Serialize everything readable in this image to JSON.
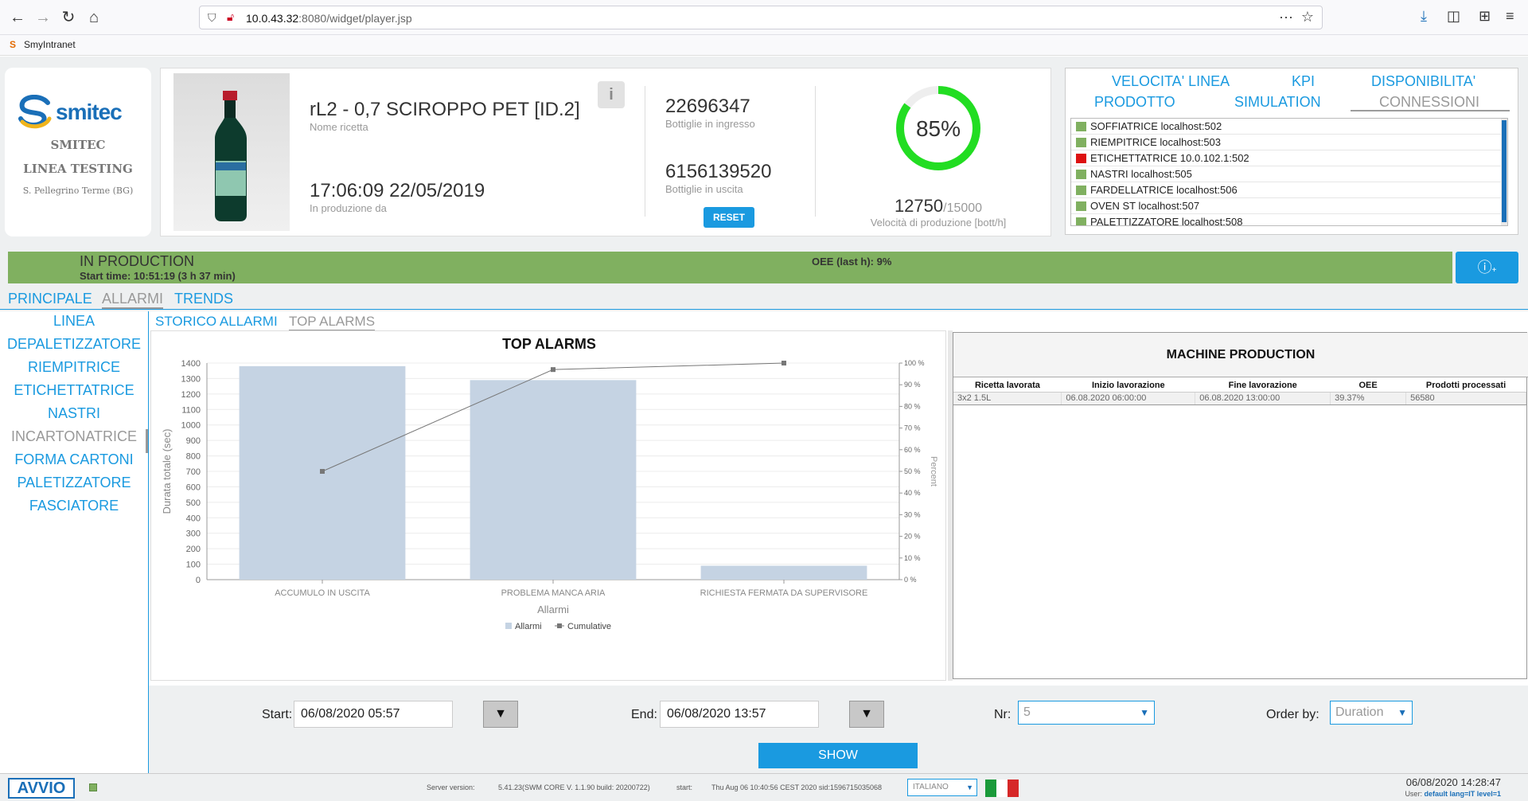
{
  "browser": {
    "url_host": "10.0.43.32",
    "url_rest": ":8080/widget/player.jsp",
    "bookmark": "SmyIntranet"
  },
  "brand": {
    "logo_text": "smitec",
    "company": "SMITEC",
    "line": "LINEA TESTING",
    "location": "S. Pellegrino Terme (BG)"
  },
  "recipe": {
    "title": "rL2 - 0,7 SCIROPPO PET [ID.2]",
    "title_label": "Nome ricetta",
    "since": "17:06:09 22/05/2019",
    "since_label": "In produzione da"
  },
  "counters": {
    "in_value": "22696347",
    "in_label": "Bottiglie in ingresso",
    "out_value": "6156139520",
    "out_label": "Bottiglie in uscita",
    "reset_label": "RESET"
  },
  "gauge": {
    "percent_text": "85%",
    "percent": 85,
    "color": "#22dd22"
  },
  "speed": {
    "value": "12750",
    "max": "/15000",
    "label": "Velocità di produzione [bott/h]"
  },
  "top_tabs": [
    {
      "label": "VELOCITA' LINEA"
    },
    {
      "label": "KPI"
    },
    {
      "label": "DISPONIBILITA'"
    },
    {
      "label": "PRODOTTO"
    },
    {
      "label": "SIMULATION"
    },
    {
      "label": "CONNESSIONI"
    }
  ],
  "connections": [
    {
      "name": "SOFFIATRICE  localhost:502",
      "color": "#80b060"
    },
    {
      "name": "RIEMPITRICE  localhost:503",
      "color": "#80b060"
    },
    {
      "name": "ETICHETTATRICE  10.0.102.1:502",
      "color": "#dd1111"
    },
    {
      "name": "NASTRI  localhost:505",
      "color": "#80b060"
    },
    {
      "name": "FARDELLATRICE  localhost:506",
      "color": "#80b060"
    },
    {
      "name": "OVEN ST  localhost:507",
      "color": "#80b060"
    },
    {
      "name": "PALETTIZZATORE  localhost:508",
      "color": "#80b060"
    }
  ],
  "status": {
    "title": "IN PRODUCTION",
    "start": "Start time: 10:51:19 (3 h 37 min)",
    "oee": "OEE (last h): 9%",
    "color": "#80b060"
  },
  "main_tabs": [
    {
      "label": "PRINCIPALE"
    },
    {
      "label": "ALLARMI"
    },
    {
      "label": "TRENDS"
    }
  ],
  "side_menu": [
    {
      "label": "LINEA"
    },
    {
      "label": "DEPALETIZZATORE"
    },
    {
      "label": "RIEMPITRICE"
    },
    {
      "label": "ETICHETTATRICE"
    },
    {
      "label": "NASTRI"
    },
    {
      "label": "INCARTONATRICE"
    },
    {
      "label": "FORMA CARTONI"
    },
    {
      "label": "PALETIZZATORE"
    },
    {
      "label": "FASCIATORE"
    }
  ],
  "sub_tabs": [
    {
      "label": "STORICO ALLARMI"
    },
    {
      "label": "TOP ALARMS"
    }
  ],
  "chart_data": {
    "type": "bar",
    "title": "TOP ALARMS",
    "xlabel": "Allarmi",
    "ylabel": "Durata totale (sec)",
    "y2label": "Percent",
    "categories": [
      "ACCUMULO IN USCITA",
      "PROBLEMA MANCA ARIA",
      "RICHIESTA FERMATA DA SUPERVISORE"
    ],
    "series": [
      {
        "name": "Allarmi",
        "type": "bar",
        "values": [
          1380,
          1290,
          90
        ]
      },
      {
        "name": "Cumulative",
        "type": "line",
        "axis": "right",
        "values": [
          50,
          97,
          100
        ]
      }
    ],
    "ylim": [
      0,
      1400
    ],
    "yticks": [
      0,
      100,
      200,
      300,
      400,
      500,
      600,
      700,
      800,
      900,
      1000,
      1100,
      1200,
      1300,
      1400
    ],
    "y2lim": [
      0,
      100
    ],
    "y2ticks": [
      "0 %",
      "10 %",
      "20 %",
      "30 %",
      "40 %",
      "50 %",
      "60 %",
      "70 %",
      "80 %",
      "90 %",
      "100 %"
    ],
    "bar_color": "#c5d3e3",
    "line_color": "#777777",
    "legend": "bottom"
  },
  "machine_production": {
    "title": "MACHINE PRODUCTION",
    "columns": [
      "Ricetta lavorata",
      "Inizio lavorazione",
      "Fine lavorazione",
      "OEE",
      "Prodotti processati"
    ],
    "rows": [
      [
        "3x2 1.5L",
        "06.08.2020 06:00:00",
        "06.08.2020 13:00:00",
        "39.37%",
        "56580"
      ]
    ]
  },
  "filters": {
    "start_label": "Start:",
    "start_value": "06/08/2020 05:57",
    "end_label": "End:",
    "end_value": "06/08/2020 13:57",
    "nr_label": "Nr:",
    "nr_value": "5",
    "order_label": "Order by:",
    "order_value": "Duration",
    "show_label": "SHOW"
  },
  "footer": {
    "avvio": "AVVIO",
    "server_label": "Server version:",
    "server_value": "5.41.23(SWM CORE V. 1.1.90 build: 20200722)",
    "start_label": "start:",
    "start_value": "Thu Aug 06 10:40:56 CEST 2020 sid:1596715035068",
    "language": "ITALIANO",
    "datetime": "06/08/2020   14:28:47",
    "user_prefix": "User: ",
    "user_value": "default lang=IT level=1"
  }
}
